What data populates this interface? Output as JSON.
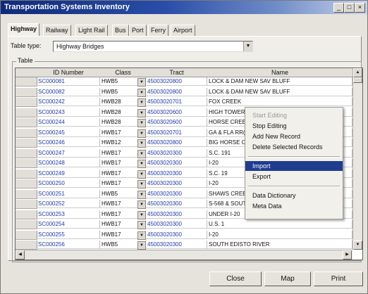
{
  "window": {
    "title": "Transportation Systems Inventory",
    "min": "_",
    "max": "□",
    "close": "×"
  },
  "tabs": [
    "Highway",
    "Railway",
    "Light Rail",
    "Bus",
    "Port",
    "Ferry",
    "Airport"
  ],
  "active_tab": "Highway",
  "table_type": {
    "label": "Table type:",
    "value": "Highway Bridges"
  },
  "group_label": "Table",
  "grid": {
    "columns": [
      "ID Number",
      "Class",
      "Tract",
      "Name"
    ],
    "rows": [
      {
        "id": "SC000081",
        "class": "HWB5",
        "tract": "45003020800",
        "name": "LOCK & DAM NEW SAV BLUFF"
      },
      {
        "id": "SC000082",
        "class": "HWB5",
        "tract": "45003020800",
        "name": "LOCK & DAM NEW SAV BLUFF"
      },
      {
        "id": "SC000242",
        "class": "HWB28",
        "tract": "45003020701",
        "name": "FOX CREEK"
      },
      {
        "id": "SC000243",
        "class": "HWB28",
        "tract": "45003020600",
        "name": "HIGH TOWER E"
      },
      {
        "id": "SC000244",
        "class": "HWB28",
        "tract": "45003020600",
        "name": "HORSE CREEK"
      },
      {
        "id": "SC000245",
        "class": "HWB17",
        "tract": "45003020701",
        "name": "GA & FLA RR(N"
      },
      {
        "id": "SC000246",
        "class": "HWB12",
        "tract": "45003020800",
        "name": "BIG HORSE CR"
      },
      {
        "id": "SC000247",
        "class": "HWB17",
        "tract": "45003020300",
        "name": "S.C. 191"
      },
      {
        "id": "SC000248",
        "class": "HWB17",
        "tract": "45003020300",
        "name": "I-20"
      },
      {
        "id": "SC000249",
        "class": "HWB17",
        "tract": "45003020300",
        "name": "S.C. 19"
      },
      {
        "id": "SC000250",
        "class": "HWB17",
        "tract": "45003020300",
        "name": "I-20"
      },
      {
        "id": "SC000251",
        "class": "HWB5",
        "tract": "45003020300",
        "name": "SHAWS CREEK"
      },
      {
        "id": "SC000252",
        "class": "HWB17",
        "tract": "45003020300",
        "name": "S-568 & SOUTH"
      },
      {
        "id": "SC000253",
        "class": "HWB17",
        "tract": "45003020300",
        "name": "UNDER I-20"
      },
      {
        "id": "SC000254",
        "class": "HWB17",
        "tract": "45003020300",
        "name": "U.S. 1"
      },
      {
        "id": "SC000255",
        "class": "HWB17",
        "tract": "45003020300",
        "name": "I-20"
      },
      {
        "id": "SC000256",
        "class": "HWB5",
        "tract": "45003020300",
        "name": "SOUTH EDISTO RIVER"
      }
    ]
  },
  "context_menu": [
    {
      "label": "Start Editing",
      "state": "disabled"
    },
    {
      "label": "Stop Editing",
      "state": "normal"
    },
    {
      "label": "Add New Record",
      "state": "normal"
    },
    {
      "label": "Delete Selected Records",
      "state": "normal"
    },
    {
      "sep": true
    },
    {
      "label": "Import",
      "state": "selected"
    },
    {
      "label": "Export",
      "state": "normal"
    },
    {
      "sep": true
    },
    {
      "label": "Data Dictionary",
      "state": "normal"
    },
    {
      "label": "Meta Data",
      "state": "normal"
    }
  ],
  "buttons": {
    "close": "Close",
    "map": "Map",
    "print": "Print"
  },
  "colors": {
    "title_start": "#0e2a7a",
    "link_blue": "#1d3aa8",
    "menu_highlight": "#1f3c8f"
  }
}
